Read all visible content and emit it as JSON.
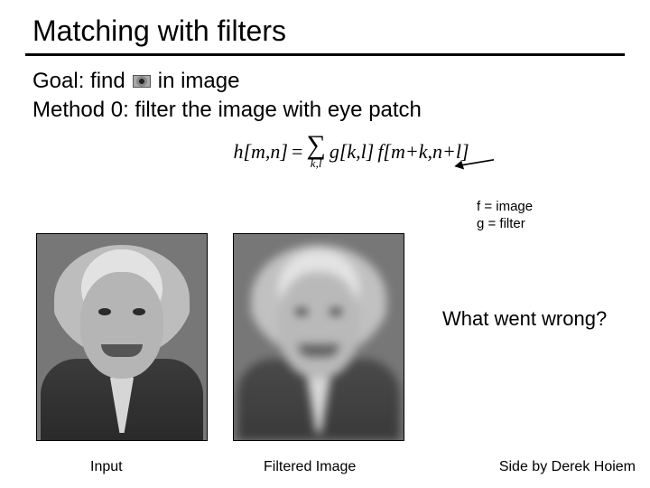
{
  "title": "Matching with filters",
  "goal": {
    "prefix": "Goal: find",
    "suffix": "in image"
  },
  "method": "Method 0: filter the image with eye patch",
  "formula": {
    "lhs": "h[m,n]",
    "eq": "=",
    "sum_sub": "k,l",
    "term_g": "g[k,l]",
    "term_f": "f[m+k,n+l]"
  },
  "legend": {
    "f": "f = image",
    "g": "g = filter"
  },
  "captions": {
    "input": "Input",
    "filtered": "Filtered Image"
  },
  "question": "What went wrong?",
  "credit": "Side by Derek Hoiem"
}
